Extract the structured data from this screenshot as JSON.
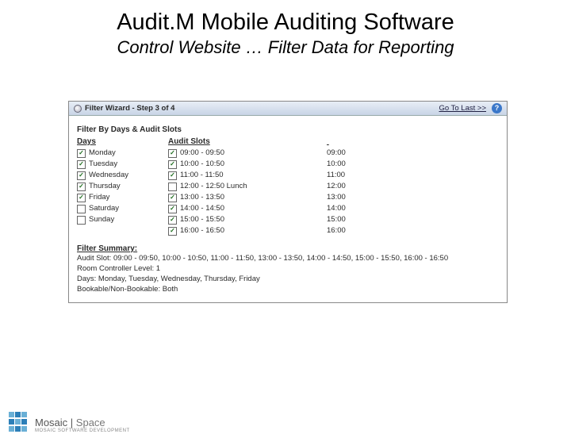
{
  "slide": {
    "title_pre": "Audit.",
    "title_m": "M",
    "title_post": " Mobile Auditing Software",
    "subtitle": "Control Website … Filter Data for Reporting"
  },
  "window": {
    "title": "Filter Wizard - Step 3 of 4",
    "goto_last": "Go To Last >>",
    "help": "?",
    "section_heading": "Filter By Days & Audit Slots",
    "days_heading": "Days",
    "slots_heading": "Audit Slots",
    "days": [
      {
        "label": "Monday",
        "checked": true
      },
      {
        "label": "Tuesday",
        "checked": true
      },
      {
        "label": "Wednesday",
        "checked": true
      },
      {
        "label": "Thursday",
        "checked": true
      },
      {
        "label": "Friday",
        "checked": true
      },
      {
        "label": "Saturday",
        "checked": false
      },
      {
        "label": "Sunday",
        "checked": false
      }
    ],
    "slots": [
      {
        "label": "09:00 - 09:50",
        "checked": true
      },
      {
        "label": "10:00 - 10:50",
        "checked": true
      },
      {
        "label": "11:00 - 11:50",
        "checked": true
      },
      {
        "label": "12:00 - 12:50 Lunch",
        "checked": false
      },
      {
        "label": "13:00 - 13:50",
        "checked": true
      },
      {
        "label": "14:00 - 14:50",
        "checked": true
      },
      {
        "label": "15:00 - 15:50",
        "checked": true
      },
      {
        "label": "16:00 - 16:50",
        "checked": true
      }
    ],
    "times": [
      "09:00",
      "10:00",
      "11:00",
      "12:00",
      "13:00",
      "14:00",
      "15:00",
      "16:00"
    ],
    "summary_heading": "Filter Summary:",
    "summary_lines": [
      "Audit Slot: 09:00 - 09:50, 10:00 - 10:50, 11:00 - 11:50, 13:00 - 13:50, 14:00 - 14:50, 15:00 - 15:50, 16:00 - 16:50",
      "Room Controller Level: 1",
      "Days: Monday, Tuesday, Wednesday, Thursday, Friday",
      "Bookable/Non-Bookable: Both"
    ]
  },
  "footer": {
    "brand_a": "Mosaic",
    "brand_sep": " | ",
    "brand_b": "Space",
    "tagline": "MOSAIC SOFTWARE DEVELOPMENT"
  }
}
